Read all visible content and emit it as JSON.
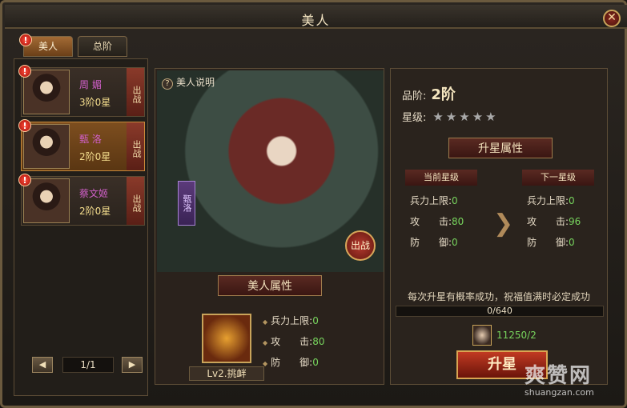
{
  "window": {
    "title": "美人",
    "close_glyph": "✕"
  },
  "tabs": [
    {
      "label": "美人",
      "active": true,
      "alert": "!"
    },
    {
      "label": "总阶",
      "active": false
    }
  ],
  "heroes": [
    {
      "name": "周 媚",
      "rank": "3阶0星",
      "deploy_label": "出战",
      "alert": "!",
      "selected": false
    },
    {
      "name": "甄 洛",
      "rank": "2阶0星",
      "deploy_label": "出战",
      "alert": "!",
      "selected": true
    },
    {
      "name": "蔡文姬",
      "rank": "2阶0星",
      "deploy_label": "出战",
      "alert": "!",
      "selected": false
    }
  ],
  "pager": {
    "prev": "◀",
    "text": "1/1",
    "next": "▶"
  },
  "center": {
    "info_link": "美人说明",
    "help_glyph": "?",
    "art_name": "甄洛",
    "deploy_button": "出战",
    "section_title": "美人属性",
    "skill_label": "Lv2.挑衅",
    "stats": [
      {
        "label": "兵力上限:",
        "value": "0"
      },
      {
        "label": "攻　　击:",
        "value": "80"
      },
      {
        "label": "防　　御:",
        "value": "0"
      }
    ]
  },
  "right": {
    "rank_label": "品阶:",
    "rank_value": "2阶",
    "star_label": "星级:",
    "stars_text": "★★★★★",
    "section_title": "升星属性",
    "current_title": "当前星级",
    "next_title": "下一星级",
    "arrow_glyph": "❯",
    "current_stats": [
      {
        "label": "兵力上限:",
        "value": "0"
      },
      {
        "label": "攻　　击:",
        "value": "80"
      },
      {
        "label": "防　　御:",
        "value": "0"
      }
    ],
    "next_stats": [
      {
        "label": "兵力上限:",
        "value": "0"
      },
      {
        "label": "攻　　击:",
        "value": "96"
      },
      {
        "label": "防　　御:",
        "value": "0"
      }
    ],
    "description": "每次升星有概率成功，祝福值满时必定成功",
    "progress_text": "0/640",
    "progress_fraction": 0,
    "cost_text": "11250/2",
    "upgrade_button": "升星"
  },
  "watermark": {
    "main": "爽赞网",
    "sub": "shuangzan.com"
  }
}
